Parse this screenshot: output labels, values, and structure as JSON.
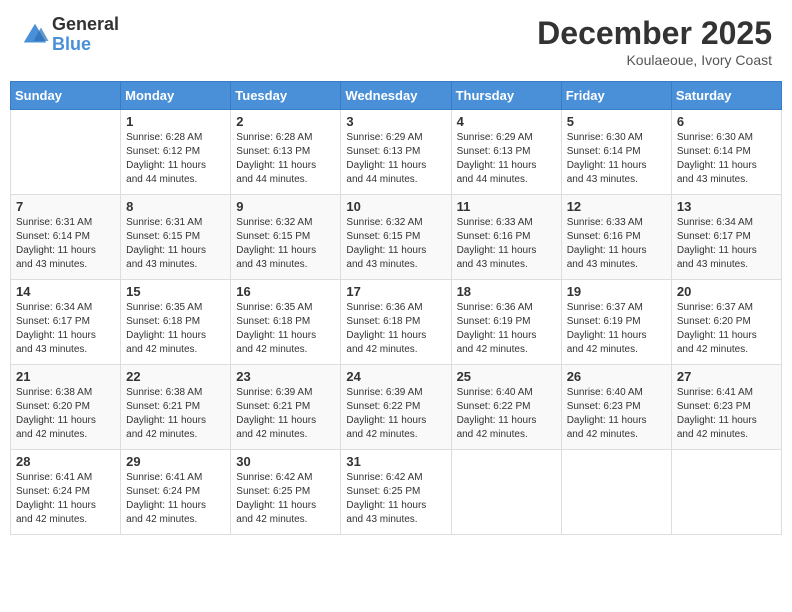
{
  "header": {
    "logo_general": "General",
    "logo_blue": "Blue",
    "month_title": "December 2025",
    "location": "Koulaeoue, Ivory Coast"
  },
  "days_of_week": [
    "Sunday",
    "Monday",
    "Tuesday",
    "Wednesday",
    "Thursday",
    "Friday",
    "Saturday"
  ],
  "weeks": [
    [
      {
        "day": "",
        "sunrise": "",
        "sunset": "",
        "daylight": ""
      },
      {
        "day": "1",
        "sunrise": "Sunrise: 6:28 AM",
        "sunset": "Sunset: 6:12 PM",
        "daylight": "Daylight: 11 hours and 44 minutes."
      },
      {
        "day": "2",
        "sunrise": "Sunrise: 6:28 AM",
        "sunset": "Sunset: 6:13 PM",
        "daylight": "Daylight: 11 hours and 44 minutes."
      },
      {
        "day": "3",
        "sunrise": "Sunrise: 6:29 AM",
        "sunset": "Sunset: 6:13 PM",
        "daylight": "Daylight: 11 hours and 44 minutes."
      },
      {
        "day": "4",
        "sunrise": "Sunrise: 6:29 AM",
        "sunset": "Sunset: 6:13 PM",
        "daylight": "Daylight: 11 hours and 44 minutes."
      },
      {
        "day": "5",
        "sunrise": "Sunrise: 6:30 AM",
        "sunset": "Sunset: 6:14 PM",
        "daylight": "Daylight: 11 hours and 43 minutes."
      },
      {
        "day": "6",
        "sunrise": "Sunrise: 6:30 AM",
        "sunset": "Sunset: 6:14 PM",
        "daylight": "Daylight: 11 hours and 43 minutes."
      }
    ],
    [
      {
        "day": "7",
        "sunrise": "Sunrise: 6:31 AM",
        "sunset": "Sunset: 6:14 PM",
        "daylight": "Daylight: 11 hours and 43 minutes."
      },
      {
        "day": "8",
        "sunrise": "Sunrise: 6:31 AM",
        "sunset": "Sunset: 6:15 PM",
        "daylight": "Daylight: 11 hours and 43 minutes."
      },
      {
        "day": "9",
        "sunrise": "Sunrise: 6:32 AM",
        "sunset": "Sunset: 6:15 PM",
        "daylight": "Daylight: 11 hours and 43 minutes."
      },
      {
        "day": "10",
        "sunrise": "Sunrise: 6:32 AM",
        "sunset": "Sunset: 6:15 PM",
        "daylight": "Daylight: 11 hours and 43 minutes."
      },
      {
        "day": "11",
        "sunrise": "Sunrise: 6:33 AM",
        "sunset": "Sunset: 6:16 PM",
        "daylight": "Daylight: 11 hours and 43 minutes."
      },
      {
        "day": "12",
        "sunrise": "Sunrise: 6:33 AM",
        "sunset": "Sunset: 6:16 PM",
        "daylight": "Daylight: 11 hours and 43 minutes."
      },
      {
        "day": "13",
        "sunrise": "Sunrise: 6:34 AM",
        "sunset": "Sunset: 6:17 PM",
        "daylight": "Daylight: 11 hours and 43 minutes."
      }
    ],
    [
      {
        "day": "14",
        "sunrise": "Sunrise: 6:34 AM",
        "sunset": "Sunset: 6:17 PM",
        "daylight": "Daylight: 11 hours and 43 minutes."
      },
      {
        "day": "15",
        "sunrise": "Sunrise: 6:35 AM",
        "sunset": "Sunset: 6:18 PM",
        "daylight": "Daylight: 11 hours and 42 minutes."
      },
      {
        "day": "16",
        "sunrise": "Sunrise: 6:35 AM",
        "sunset": "Sunset: 6:18 PM",
        "daylight": "Daylight: 11 hours and 42 minutes."
      },
      {
        "day": "17",
        "sunrise": "Sunrise: 6:36 AM",
        "sunset": "Sunset: 6:18 PM",
        "daylight": "Daylight: 11 hours and 42 minutes."
      },
      {
        "day": "18",
        "sunrise": "Sunrise: 6:36 AM",
        "sunset": "Sunset: 6:19 PM",
        "daylight": "Daylight: 11 hours and 42 minutes."
      },
      {
        "day": "19",
        "sunrise": "Sunrise: 6:37 AM",
        "sunset": "Sunset: 6:19 PM",
        "daylight": "Daylight: 11 hours and 42 minutes."
      },
      {
        "day": "20",
        "sunrise": "Sunrise: 6:37 AM",
        "sunset": "Sunset: 6:20 PM",
        "daylight": "Daylight: 11 hours and 42 minutes."
      }
    ],
    [
      {
        "day": "21",
        "sunrise": "Sunrise: 6:38 AM",
        "sunset": "Sunset: 6:20 PM",
        "daylight": "Daylight: 11 hours and 42 minutes."
      },
      {
        "day": "22",
        "sunrise": "Sunrise: 6:38 AM",
        "sunset": "Sunset: 6:21 PM",
        "daylight": "Daylight: 11 hours and 42 minutes."
      },
      {
        "day": "23",
        "sunrise": "Sunrise: 6:39 AM",
        "sunset": "Sunset: 6:21 PM",
        "daylight": "Daylight: 11 hours and 42 minutes."
      },
      {
        "day": "24",
        "sunrise": "Sunrise: 6:39 AM",
        "sunset": "Sunset: 6:22 PM",
        "daylight": "Daylight: 11 hours and 42 minutes."
      },
      {
        "day": "25",
        "sunrise": "Sunrise: 6:40 AM",
        "sunset": "Sunset: 6:22 PM",
        "daylight": "Daylight: 11 hours and 42 minutes."
      },
      {
        "day": "26",
        "sunrise": "Sunrise: 6:40 AM",
        "sunset": "Sunset: 6:23 PM",
        "daylight": "Daylight: 11 hours and 42 minutes."
      },
      {
        "day": "27",
        "sunrise": "Sunrise: 6:41 AM",
        "sunset": "Sunset: 6:23 PM",
        "daylight": "Daylight: 11 hours and 42 minutes."
      }
    ],
    [
      {
        "day": "28",
        "sunrise": "Sunrise: 6:41 AM",
        "sunset": "Sunset: 6:24 PM",
        "daylight": "Daylight: 11 hours and 42 minutes."
      },
      {
        "day": "29",
        "sunrise": "Sunrise: 6:41 AM",
        "sunset": "Sunset: 6:24 PM",
        "daylight": "Daylight: 11 hours and 42 minutes."
      },
      {
        "day": "30",
        "sunrise": "Sunrise: 6:42 AM",
        "sunset": "Sunset: 6:25 PM",
        "daylight": "Daylight: 11 hours and 42 minutes."
      },
      {
        "day": "31",
        "sunrise": "Sunrise: 6:42 AM",
        "sunset": "Sunset: 6:25 PM",
        "daylight": "Daylight: 11 hours and 43 minutes."
      },
      {
        "day": "",
        "sunrise": "",
        "sunset": "",
        "daylight": ""
      },
      {
        "day": "",
        "sunrise": "",
        "sunset": "",
        "daylight": ""
      },
      {
        "day": "",
        "sunrise": "",
        "sunset": "",
        "daylight": ""
      }
    ]
  ]
}
